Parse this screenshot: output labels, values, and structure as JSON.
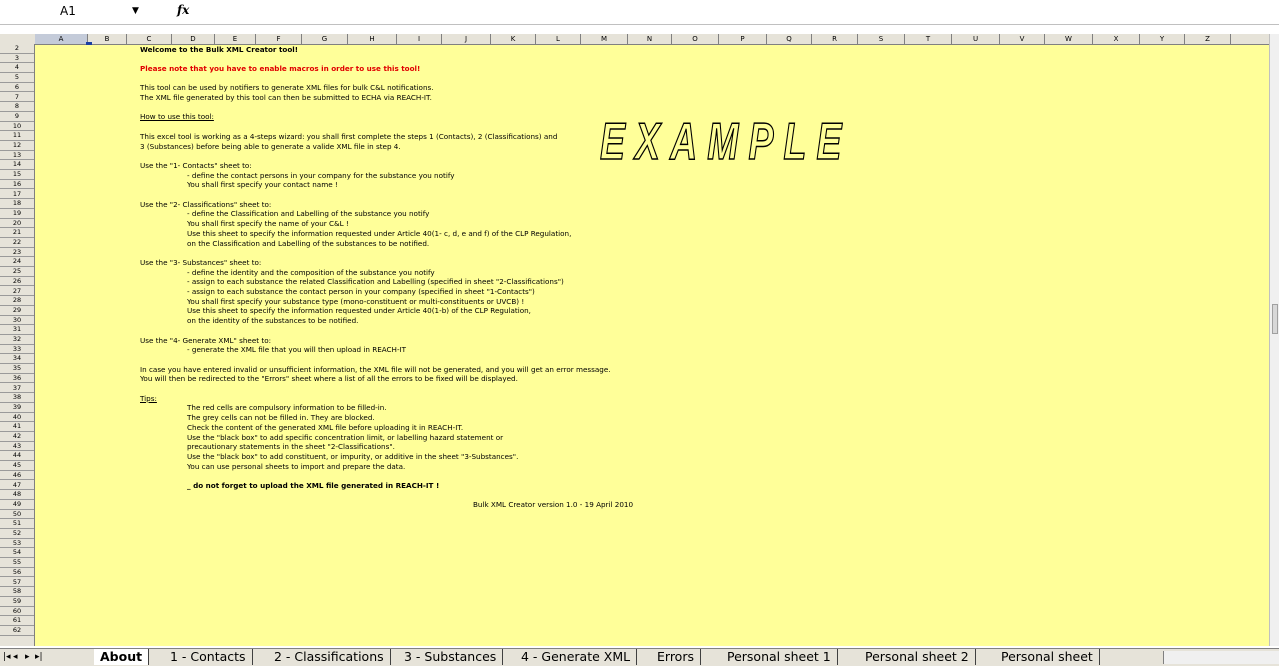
{
  "formula_bar": {
    "cell_ref": "A1",
    "fx_label": "fx",
    "formula": ""
  },
  "columns": [
    "A",
    "B",
    "C",
    "D",
    "E",
    "F",
    "G",
    "H",
    "I",
    "J",
    "K",
    "L",
    "M",
    "N",
    "O",
    "P",
    "Q",
    "R",
    "S",
    "T",
    "U",
    "V",
    "W",
    "X",
    "Y",
    "Z"
  ],
  "rows": [
    "2",
    "3",
    "4",
    "5",
    "6",
    "7",
    "8",
    "9",
    "10",
    "11",
    "12",
    "13",
    "14",
    "15",
    "16",
    "17",
    "18",
    "19",
    "20",
    "21",
    "22",
    "23",
    "24",
    "25",
    "26",
    "27",
    "28",
    "29",
    "30",
    "31",
    "32",
    "33",
    "34",
    "35",
    "36",
    "37",
    "38",
    "39",
    "40",
    "41",
    "42",
    "43",
    "44",
    "45",
    "46",
    "47",
    "48",
    "49",
    "50",
    "51",
    "52",
    "53",
    "54",
    "55",
    "56",
    "57",
    "58",
    "59",
    "60",
    "61",
    "62"
  ],
  "example_watermark": "EXAMPLE",
  "lines": [
    {
      "text": "Welcome to the Bulk XML Creator tool!",
      "style": "b"
    },
    {
      "text": "Please note that you have to enable macros in order to use this tool!",
      "style": "red"
    },
    {
      "text": "This tool can be used by notifiers to generate XML files for bulk C&L notifications.",
      "style": ""
    },
    {
      "text": "The XML file generated by this tool can then be submitted to ECHA via REACH-IT.",
      "style": ""
    },
    {
      "text": "How to use this tool:",
      "style": "u"
    },
    {
      "text": "This excel tool is working as a 4-steps wizard: you shall first complete the steps 1 (Contacts), 2 (Classifications) and",
      "style": ""
    },
    {
      "text": "3 (Substances) before being able to generate a valide XML file in step 4.",
      "style": ""
    },
    {
      "text": "Use the \"1- Contacts\" sheet to:",
      "style": ""
    },
    {
      "text": "- define the contact persons in your company for the substance you notify",
      "style": ""
    },
    {
      "text": "You shall first specify your contact name !",
      "style": ""
    },
    {
      "text": "Use the \"2- Classifications\" sheet to:",
      "style": ""
    },
    {
      "text": "- define the Classification and Labelling of the substance you notify",
      "style": ""
    },
    {
      "text": "You shall first specify the name of your C&L !",
      "style": ""
    },
    {
      "text": "Use this sheet to specify the information requested under Article 40(1- c, d, e and f) of the CLP Regulation,",
      "style": ""
    },
    {
      "text": "on the Classification and Labelling of the substances to be notified.",
      "style": ""
    },
    {
      "text": "Use the \"3- Substances\" sheet to:",
      "style": ""
    },
    {
      "text": "- define the identity and the composition of the substance you notify",
      "style": ""
    },
    {
      "text": "- assign to each substance the related Classification and Labelling (specified in sheet \"2-Classifications\")",
      "style": ""
    },
    {
      "text": "- assign to each substance the contact person in your company (specified in sheet \"1-Contacts\")",
      "style": ""
    },
    {
      "text": "You shall first specify your substance type (mono-constituent or multi-constituents or UVCB) !",
      "style": ""
    },
    {
      "text": "Use this sheet to specify the information requested under Article 40(1-b) of the CLP Regulation,",
      "style": ""
    },
    {
      "text": "on the identity of the substances to be notified.",
      "style": ""
    },
    {
      "text": "Use the \"4- Generate XML\" sheet to:",
      "style": ""
    },
    {
      "text": "- generate the XML file that you will then upload in REACH-IT",
      "style": ""
    },
    {
      "text": "In case you have entered invalid or unsufficient information, the XML file will not be generated, and you will get an error message.",
      "style": ""
    },
    {
      "text": "You will then be redirected to the \"Errors\" sheet where a list of all the errors to be fixed will be displayed.",
      "style": ""
    },
    {
      "text": "Tips:",
      "style": "u"
    },
    {
      "text": "The red cells are compulsory information to be filled-in.",
      "style": ""
    },
    {
      "text": "The grey cells can not be filled in. They are blocked.",
      "style": ""
    },
    {
      "text": "Check the content of the generated XML file before uploading it in REACH-IT.",
      "style": ""
    },
    {
      "text": "Use the \"black box\" to add specific concentration limit, or labelling hazard statement or",
      "style": ""
    },
    {
      "text": "precautionary statements in the sheet \"2-Classifications\".",
      "style": ""
    },
    {
      "text": "Use the \"black box\" to add constituent, or impurity, or additive in the sheet \"3-Substances\".",
      "style": ""
    },
    {
      "text": "You can use personal sheets to import and prepare the data.",
      "style": ""
    },
    {
      "text": "_ do not forget to upload the XML file generated in REACH-IT !",
      "style": "b"
    },
    {
      "text": "Bulk XML Creator version 1.0 - 19 April 2010",
      "style": ""
    }
  ],
  "tabs": [
    "About",
    "1 - Contacts",
    "2 - Classifications",
    "3 - Substances",
    "4 - Generate XML",
    "Errors",
    "Personal sheet 1",
    "Personal sheet 2",
    "Personal sheet"
  ],
  "active_tab": "About",
  "tab_nav": [
    "|◂",
    "◂",
    "▸",
    "▸|"
  ],
  "colors": {
    "sheet_bg": "#ffff99",
    "header_bg": "#e6e3d9",
    "warning_red": "#e00000"
  }
}
